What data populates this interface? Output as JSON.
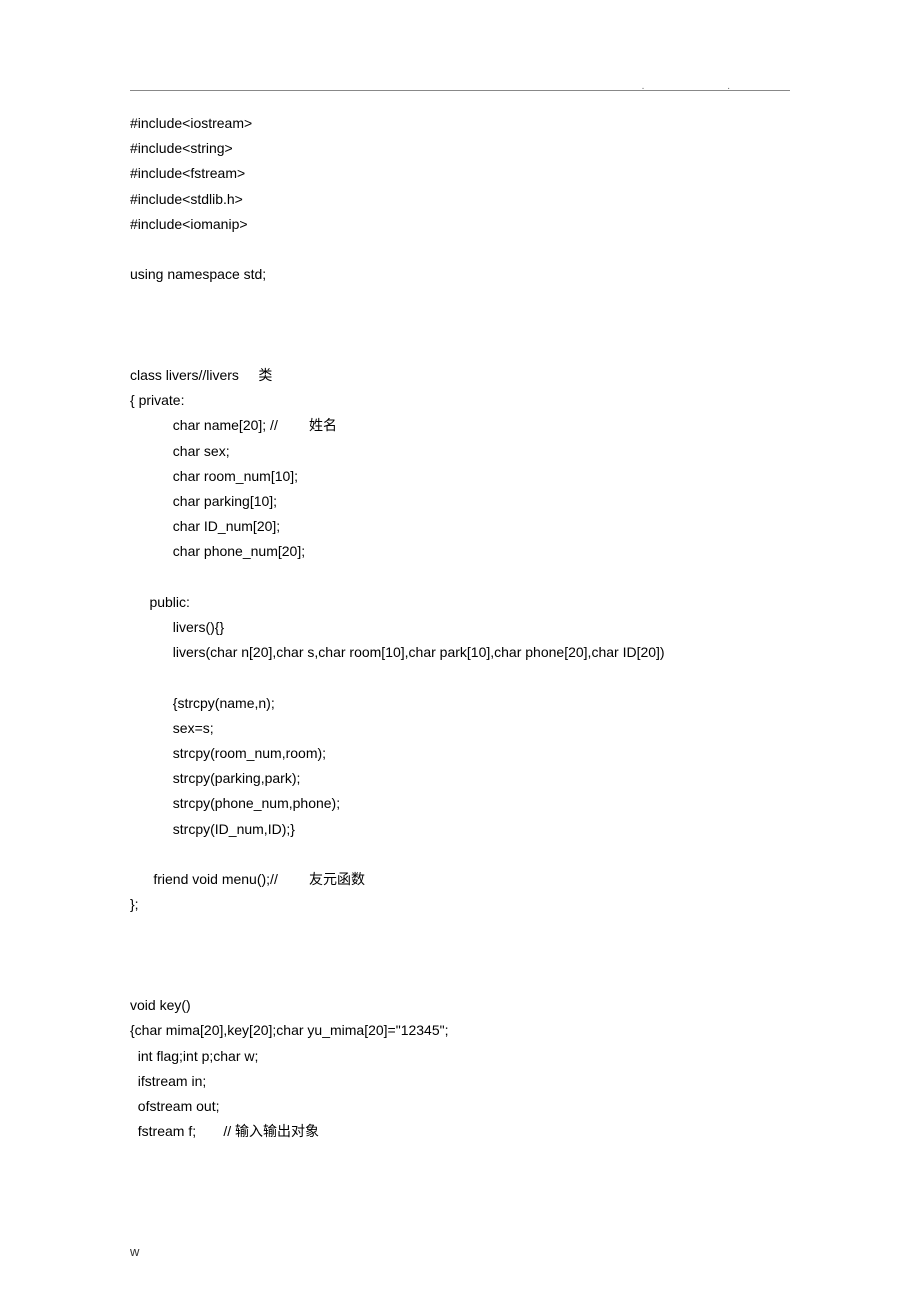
{
  "header": {
    "dots": ".  ."
  },
  "code": {
    "lines": [
      "#include<iostream>",
      "#include<string>",
      "#include<fstream>",
      "#include<stdlib.h>",
      "#include<iomanip>",
      "",
      "using namespace std;",
      "",
      "",
      "",
      "class livers//livers     类",
      "{ private:",
      "           char name[20]; //        姓名",
      "           char sex;",
      "           char room_num[10];",
      "           char parking[10];",
      "           char ID_num[20];",
      "           char phone_num[20];",
      "",
      "     public:",
      "           livers(){}",
      "           livers(char n[20],char s,char room[10],char park[10],char phone[20],char ID[20])",
      "",
      "           {strcpy(name,n);",
      "           sex=s;",
      "           strcpy(room_num,room);",
      "           strcpy(parking,park);",
      "           strcpy(phone_num,phone);",
      "           strcpy(ID_num,ID);}",
      "",
      "      friend void menu();//        友元函数",
      "};",
      "",
      "",
      "",
      "void key()",
      "{char mima[20],key[20];char yu_mima[20]=\"12345\";",
      "  int flag;int p;char w;",
      "  ifstream in;",
      "  ofstream out;",
      "  fstream f;       // 输入输出对象"
    ]
  },
  "footer": {
    "text": "w"
  }
}
